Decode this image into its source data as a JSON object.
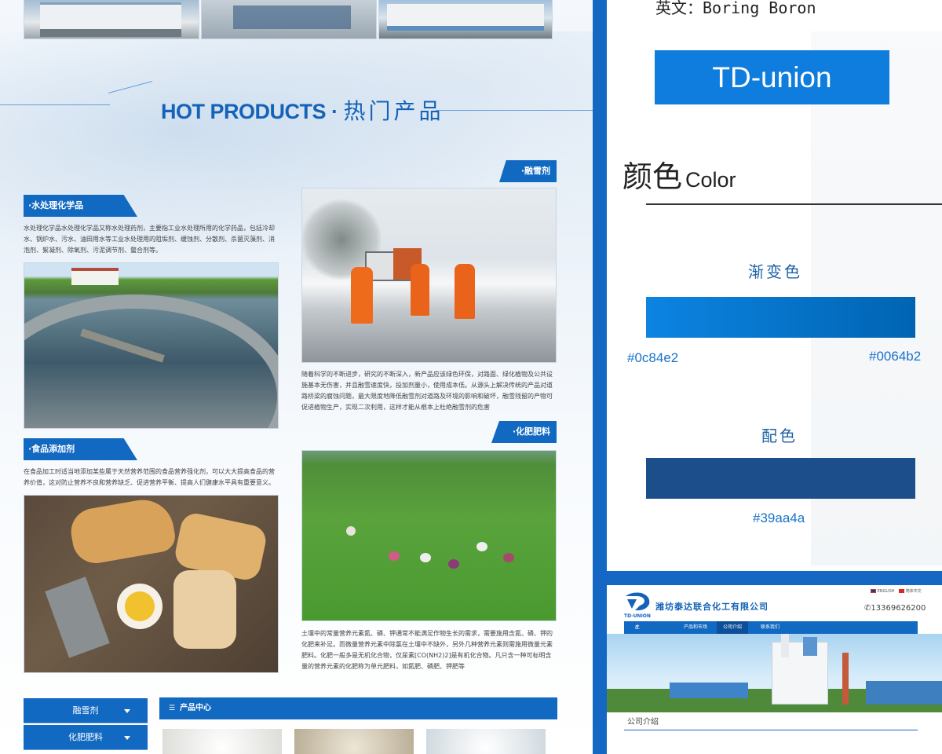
{
  "left": {
    "hot_en": "HOT PRODUCTS · ",
    "hot_cn": "热门产品",
    "sections": {
      "water": {
        "tag": "·水处理化学品",
        "desc": "水处理化学品水处理化学品又称水处理药剂，主要指工业水处理所用的化学药品，包括冷却水、锅炉水、污水、油田用水等工业水处理用的阻垢剂、缓蚀剂、分散剂、杀菌灭藻剂、消泡剂、絮凝剂、除氧剂、污泥调节剂、螯合剂等。"
      },
      "snow": {
        "tag": "·融雪剂",
        "desc": "随着科学的不断进步，研究的不断深入，新产品应该绿色环保，对路面、绿化植物及公共设施基本无伤害，并且融雪速度快，投加剂量小，使用成本低。从源头上解决传统的产品对道路桥梁的腐蚀问题，最大限度地降低融雪剂对道路及环境的影响和破坏，融雪残留的产物可促进植物生产，实现二次利用，这样才能从根本上杜绝融雪剂的危害"
      },
      "food": {
        "tag": "·食品添加剂",
        "desc": "在食品加工时适当地添加某些属于天然营养范围的食品营养强化剂，可以大大提高食品的营养价值，这对防止营养不良和营养缺乏、促进营养平衡、提高人们健康水平具有重要意义。"
      },
      "fert": {
        "tag": "·化肥肥料",
        "desc": "土壤中的常量营养元素氮、磷、钾通常不能满足作物生长的需求，需要施用含氮、磷、钾的化肥来补足。而微量营养元素中除氯在土壤中不缺外，另外几种营养元素则需施用微量元素肥料。化肥一般多是无机化合物，仅尿素[CO(NH2)2]是有机化合物。凡只含一种可标明含量的营养元素的化肥称为单元肥料，如氮肥、磷肥、钾肥等"
      }
    },
    "side_buttons": [
      "融雪剂",
      "化肥肥料"
    ],
    "product_center": "产品中心"
  },
  "right": {
    "english_name": "英文：Boring Boron",
    "logo_text": "TD-union",
    "color_title_cn": "颜色",
    "color_title_en": "Color",
    "gradient_title": "渐变色",
    "gradient_start": "#0c84e2",
    "gradient_end": "#0064b2",
    "match_title": "配色",
    "match_color": "#39aa4a"
  },
  "preview": {
    "logo_sub": "TD-UNION",
    "company": "潍坊泰达联合化工有限公司",
    "lang_en": "ENGLISH",
    "lang_cn": "简体中文",
    "phone": "13369626200",
    "nav": [
      "主页",
      "产品和市场",
      "公司介绍",
      "联系我们"
    ],
    "intro_title": "公司介绍"
  }
}
